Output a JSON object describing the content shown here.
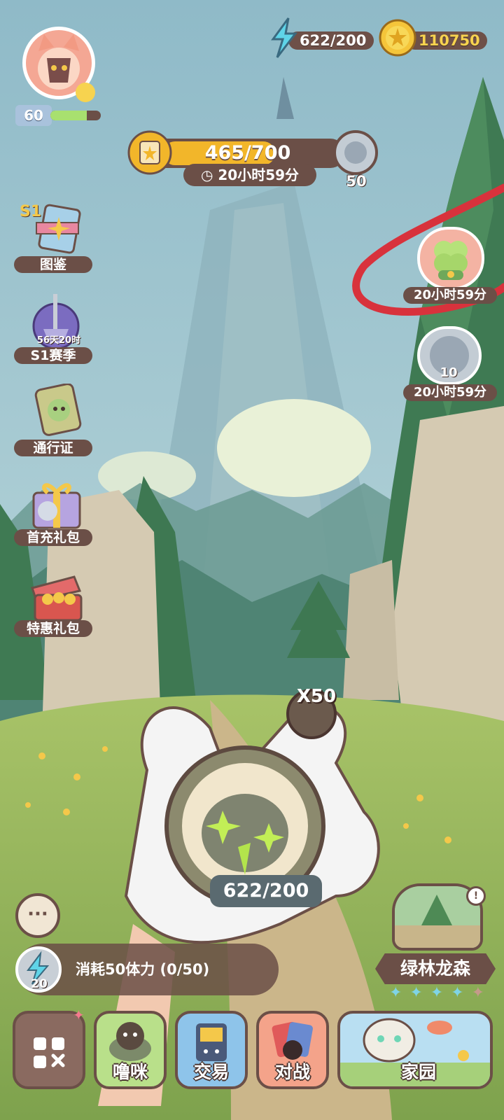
{
  "player": {
    "level": "60",
    "level_progress": 0.72
  },
  "resources": {
    "stamina": "622/200",
    "coins": "110750"
  },
  "battle_pass": {
    "progress": "465/700",
    "progress_fraction": 0.66,
    "timer": "20小时59分",
    "reward_count": "50"
  },
  "left_menu": {
    "season_badge": "S1",
    "items": [
      {
        "label": "图鉴"
      },
      {
        "label": "S1赛季",
        "sub": "56天20时"
      },
      {
        "label": "通行证"
      },
      {
        "label": "首充礼包"
      },
      {
        "label": "特惠礼包"
      }
    ]
  },
  "right_events": [
    {
      "timer": "20小时59分"
    },
    {
      "timer": "20小时59分",
      "count": "10"
    }
  ],
  "gacha": {
    "multiplier": "X50",
    "stamina_display": "622/200"
  },
  "consume": {
    "text": "消耗50体力 (0/50)",
    "icon_count": "20"
  },
  "map": {
    "name": "绿林龙森",
    "stars": "5",
    "filled_stars": 4
  },
  "bottom_nav": {
    "items": [
      {
        "label": "噜咪"
      },
      {
        "label": "交易"
      },
      {
        "label": "对战"
      },
      {
        "label": "家园"
      }
    ]
  },
  "colors": {
    "panel": "#6b4f47",
    "accent_gold": "#f2b62a",
    "highlight_red": "#d8323c"
  }
}
